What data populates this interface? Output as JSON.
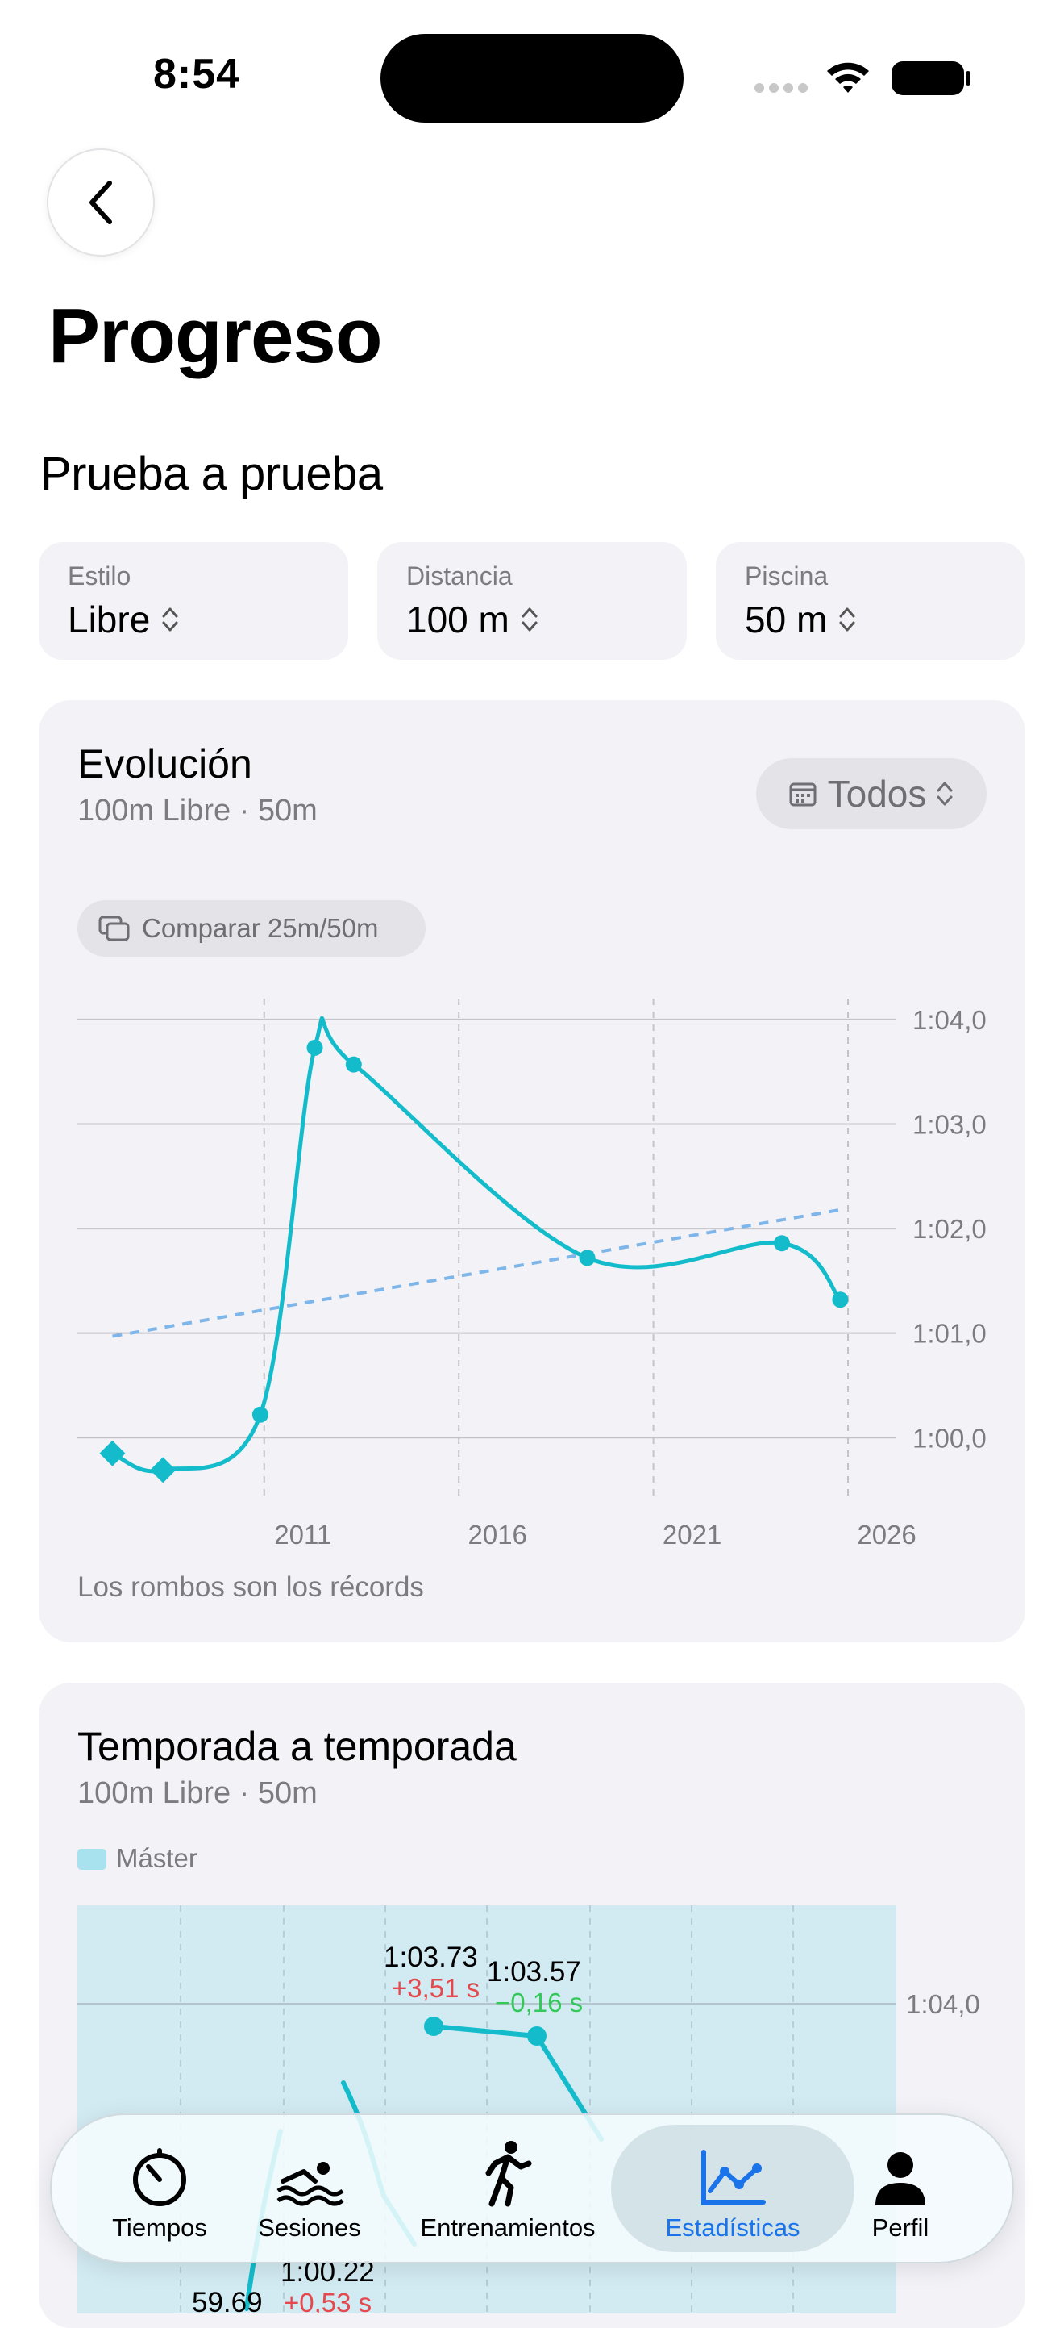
{
  "status": {
    "time": "8:54"
  },
  "header": {
    "title": "Progreso",
    "section": "Prueba a prueba"
  },
  "filters": [
    {
      "label": "Estilo",
      "value": "Libre"
    },
    {
      "label": "Distancia",
      "value": "100 m"
    },
    {
      "label": "Piscina",
      "value": "50 m"
    }
  ],
  "evolution": {
    "title": "Evolución",
    "subtitle": "100m Libre · 50m",
    "range_button": "Todos",
    "compare_button": "Comparar 25m/50m",
    "footnote": "Los rombos son los récords"
  },
  "season": {
    "title": "Temporada a temporada",
    "subtitle": "100m Libre · 50m",
    "legend": "Máster",
    "y_tick": "1:04,0",
    "annotations": [
      {
        "time": "1:03.73",
        "delta": "+3,51 s",
        "trend": "up"
      },
      {
        "time": "1:03.57",
        "delta": "−0,16 s",
        "trend": "down"
      },
      {
        "time": "1:00.22",
        "delta": "+0,53 s",
        "trend": "up"
      },
      {
        "time": "59.69",
        "delta": "",
        "trend": ""
      }
    ]
  },
  "tabs": [
    {
      "label": "Tiempos",
      "icon": "stopwatch-icon",
      "active": false
    },
    {
      "label": "Sesiones",
      "icon": "swimmer-icon",
      "active": false
    },
    {
      "label": "Entrenamientos",
      "icon": "runner-icon",
      "active": false
    },
    {
      "label": "Estadísticas",
      "icon": "chart-line-icon",
      "active": true
    },
    {
      "label": "Perfil",
      "icon": "person-icon",
      "active": false
    }
  ],
  "colors": {
    "series": "#14bccb",
    "trend": "#7fb6ea",
    "active_tab": "#1a73e8",
    "gain": "#e5484d",
    "loss": "#34c759"
  },
  "chart_data": [
    {
      "type": "line",
      "title": "Evolución",
      "subtitle": "100m Libre · 50m",
      "x_unit": "year",
      "y_unit": "seconds",
      "xlim": [
        2006.2,
        2027.2
      ],
      "ylim": [
        59.4,
        64.2
      ],
      "x_ticks": [
        2011,
        2016,
        2021,
        2026
      ],
      "y_ticks": [
        60,
        61,
        62,
        63,
        64
      ],
      "y_tick_labels": [
        "1:00,0",
        "1:01,0",
        "1:02,0",
        "1:03,0",
        "1:04,0"
      ],
      "x_grid": [
        2011,
        2016,
        2021,
        2026
      ],
      "series": [
        {
          "x": [
            2007.1,
            2008.4,
            2010.9,
            2012.3,
            2013.3,
            2019.3,
            2024.3,
            2025.8
          ],
          "y": [
            59.85,
            59.69,
            60.22,
            63.73,
            63.57,
            61.72,
            61.86,
            61.32
          ],
          "record": [
            true,
            true,
            false,
            false,
            false,
            false,
            false,
            false
          ]
        }
      ],
      "trendline": {
        "x": [
          2007.1,
          2025.8
        ],
        "y": [
          60.97,
          62.18
        ]
      },
      "grid": true
    },
    {
      "type": "line",
      "title": "Temporada a temporada",
      "subtitle": "100m Libre · 50m",
      "legend": [
        "Máster"
      ],
      "y_ticks": [
        "1:04,0"
      ],
      "series": [
        {
          "name": "Máster",
          "values": [
            59.69,
            60.22,
            63.73,
            63.57
          ]
        }
      ]
    }
  ]
}
